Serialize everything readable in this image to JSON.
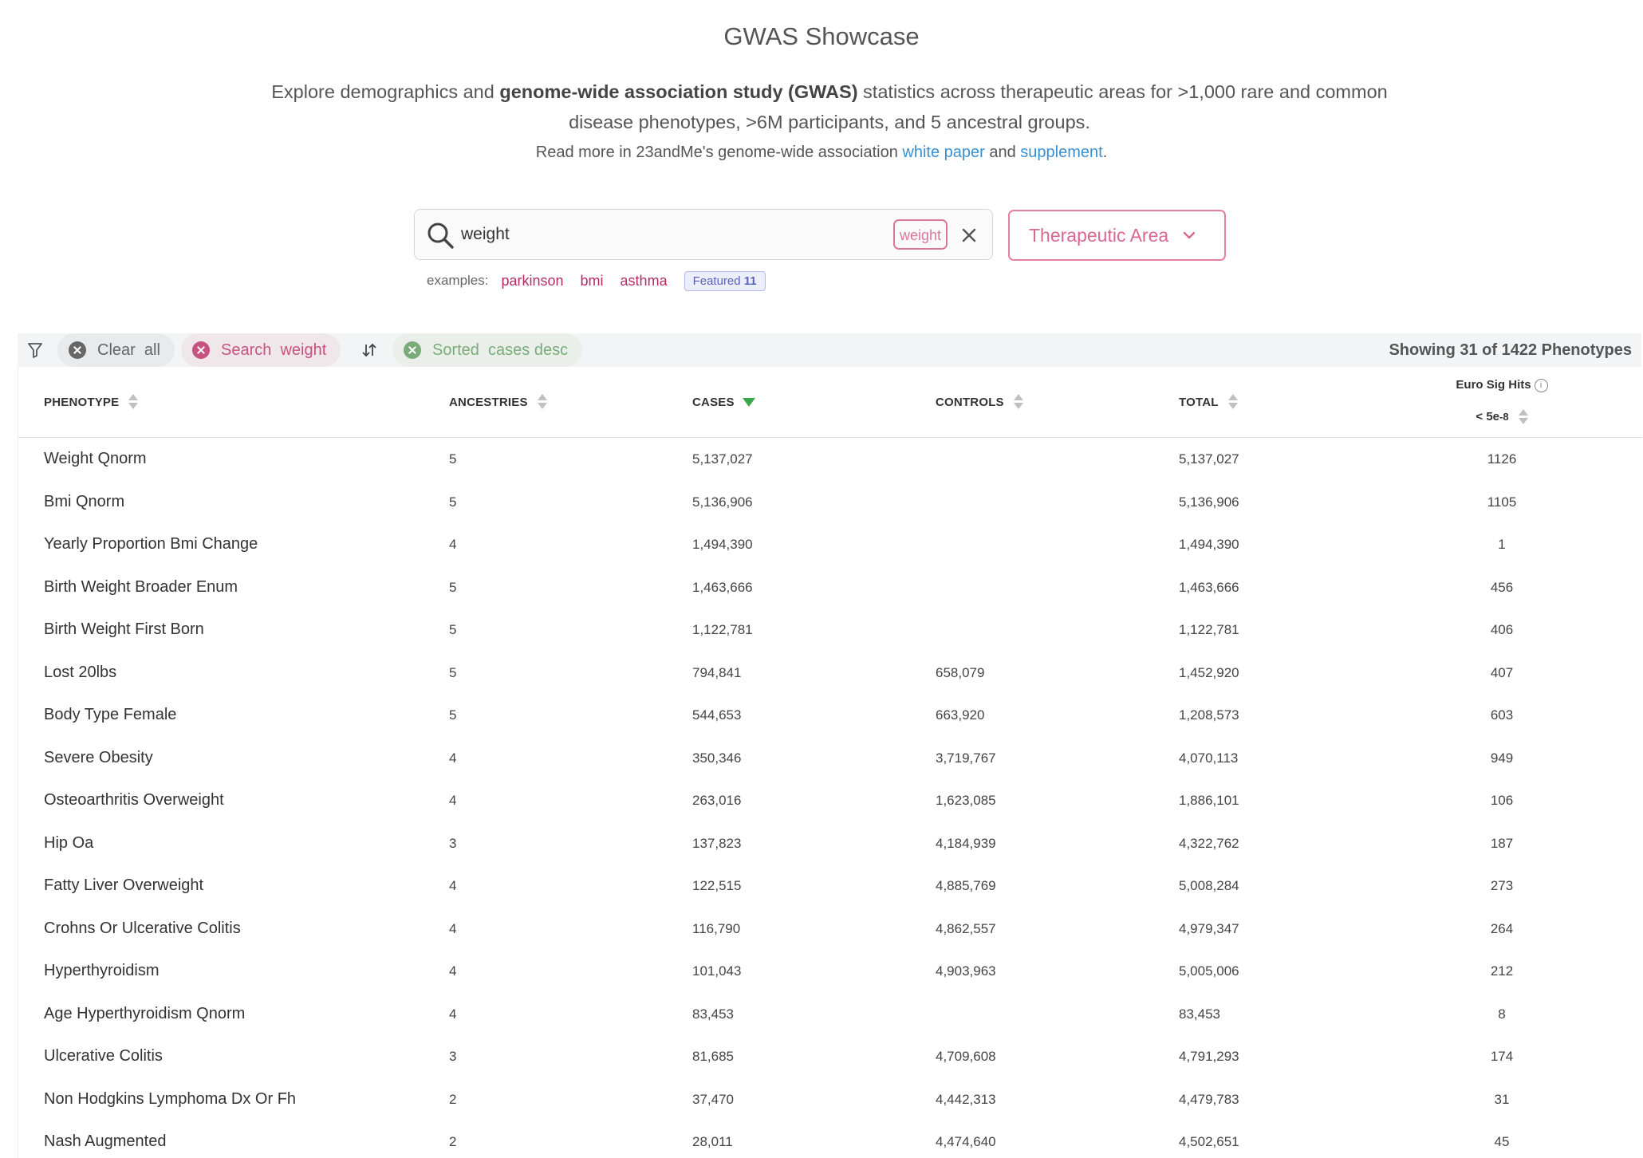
{
  "page": {
    "title": "GWAS Showcase",
    "intro_before": "Explore demographics and ",
    "intro_bold": "genome-wide association study (GWAS)",
    "intro_after": " statistics across therapeutic areas for >1,000 rare and common disease phenotypes, >6M participants, and 5 ancestral groups.",
    "readmore_before": "Read more in 23andMe's genome-wide association ",
    "readmore_link1": "white paper",
    "readmore_mid": " and ",
    "readmore_link2": "supplement",
    "readmore_end": "."
  },
  "search": {
    "value": "weight",
    "chip": "weight"
  },
  "therapeutic_area": {
    "label": "Therapeutic Area"
  },
  "examples": {
    "label": "examples:",
    "items": [
      "parkinson",
      "bmi",
      "asthma"
    ],
    "featured_label": "Featured",
    "featured_count": "11"
  },
  "filterbar": {
    "clear_label": "Clear  all",
    "search_label": "Search  weight",
    "sort_label": "Sorted  cases desc",
    "showing": "Showing 31 of 1422 Phenotypes"
  },
  "columns": {
    "phenotype": "PHENOTYPE",
    "ancestries": "ANCESTRIES",
    "cases": "CASES",
    "controls": "CONTROLS",
    "total": "TOTAL",
    "euro_line1": "Euro Sig Hits",
    "euro_line2": "< 5e",
    "euro_sup": "-8"
  },
  "rows": [
    {
      "phenotype": "Weight Qnorm",
      "ancestries": "5",
      "cases": "5,137,027",
      "controls": "",
      "total": "5,137,027",
      "hits": "1126"
    },
    {
      "phenotype": "Bmi Qnorm",
      "ancestries": "5",
      "cases": "5,136,906",
      "controls": "",
      "total": "5,136,906",
      "hits": "1105"
    },
    {
      "phenotype": "Yearly Proportion Bmi Change",
      "ancestries": "4",
      "cases": "1,494,390",
      "controls": "",
      "total": "1,494,390",
      "hits": "1"
    },
    {
      "phenotype": "Birth Weight Broader Enum",
      "ancestries": "5",
      "cases": "1,463,666",
      "controls": "",
      "total": "1,463,666",
      "hits": "456"
    },
    {
      "phenotype": "Birth Weight First Born",
      "ancestries": "5",
      "cases": "1,122,781",
      "controls": "",
      "total": "1,122,781",
      "hits": "406"
    },
    {
      "phenotype": "Lost 20lbs",
      "ancestries": "5",
      "cases": "794,841",
      "controls": "658,079",
      "total": "1,452,920",
      "hits": "407"
    },
    {
      "phenotype": "Body Type Female",
      "ancestries": "5",
      "cases": "544,653",
      "controls": "663,920",
      "total": "1,208,573",
      "hits": "603"
    },
    {
      "phenotype": "Severe Obesity",
      "ancestries": "4",
      "cases": "350,346",
      "controls": "3,719,767",
      "total": "4,070,113",
      "hits": "949"
    },
    {
      "phenotype": "Osteoarthritis Overweight",
      "ancestries": "4",
      "cases": "263,016",
      "controls": "1,623,085",
      "total": "1,886,101",
      "hits": "106"
    },
    {
      "phenotype": "Hip Oa",
      "ancestries": "3",
      "cases": "137,823",
      "controls": "4,184,939",
      "total": "4,322,762",
      "hits": "187"
    },
    {
      "phenotype": "Fatty Liver Overweight",
      "ancestries": "4",
      "cases": "122,515",
      "controls": "4,885,769",
      "total": "5,008,284",
      "hits": "273"
    },
    {
      "phenotype": "Crohns Or Ulcerative Colitis",
      "ancestries": "4",
      "cases": "116,790",
      "controls": "4,862,557",
      "total": "4,979,347",
      "hits": "264"
    },
    {
      "phenotype": "Hyperthyroidism",
      "ancestries": "4",
      "cases": "101,043",
      "controls": "4,903,963",
      "total": "5,005,006",
      "hits": "212"
    },
    {
      "phenotype": "Age Hyperthyroidism Qnorm",
      "ancestries": "4",
      "cases": "83,453",
      "controls": "",
      "total": "83,453",
      "hits": "8"
    },
    {
      "phenotype": "Ulcerative Colitis",
      "ancestries": "3",
      "cases": "81,685",
      "controls": "4,709,608",
      "total": "4,791,293",
      "hits": "174"
    },
    {
      "phenotype": "Non Hodgkins Lymphoma Dx Or Fh",
      "ancestries": "2",
      "cases": "37,470",
      "controls": "4,442,313",
      "total": "4,479,783",
      "hits": "31"
    },
    {
      "phenotype": "Nash Augmented",
      "ancestries": "2",
      "cases": "28,011",
      "controls": "4,474,640",
      "total": "4,502,651",
      "hits": "45"
    }
  ],
  "colors": {
    "accent_pink": "#d96891",
    "link_blue": "#3a8fd0",
    "sort_green": "#3aa84a",
    "example_link": "#b22d66"
  }
}
